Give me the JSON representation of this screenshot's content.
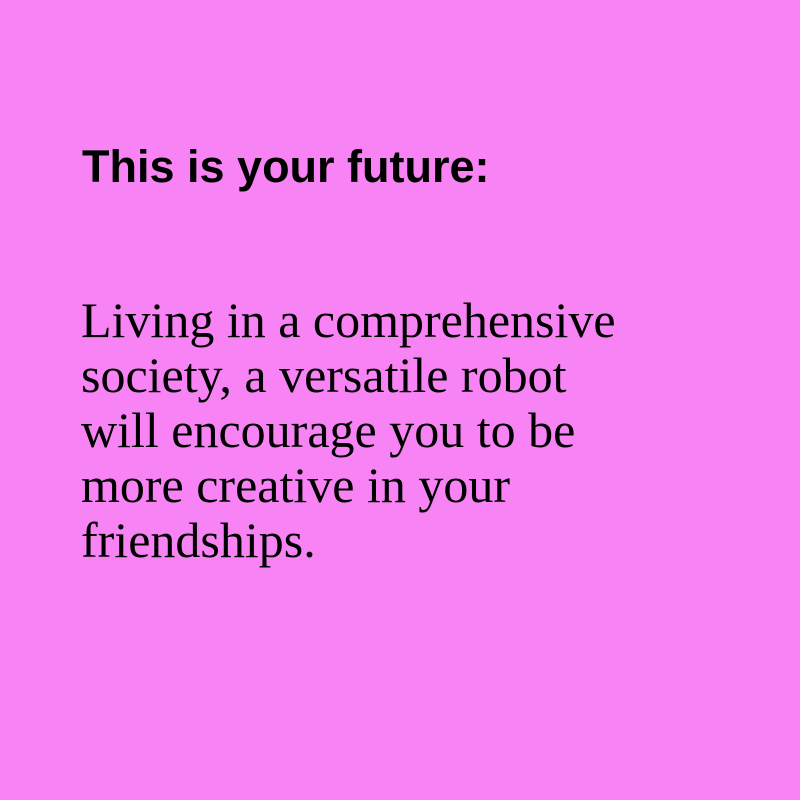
{
  "background_color": "#f783f4",
  "heading": "This is your future:",
  "body_lines": [
    "Living in a comprehensive",
    "society, a versatile robot",
    "will encourage you to be",
    "more creative in your",
    "friendships."
  ]
}
